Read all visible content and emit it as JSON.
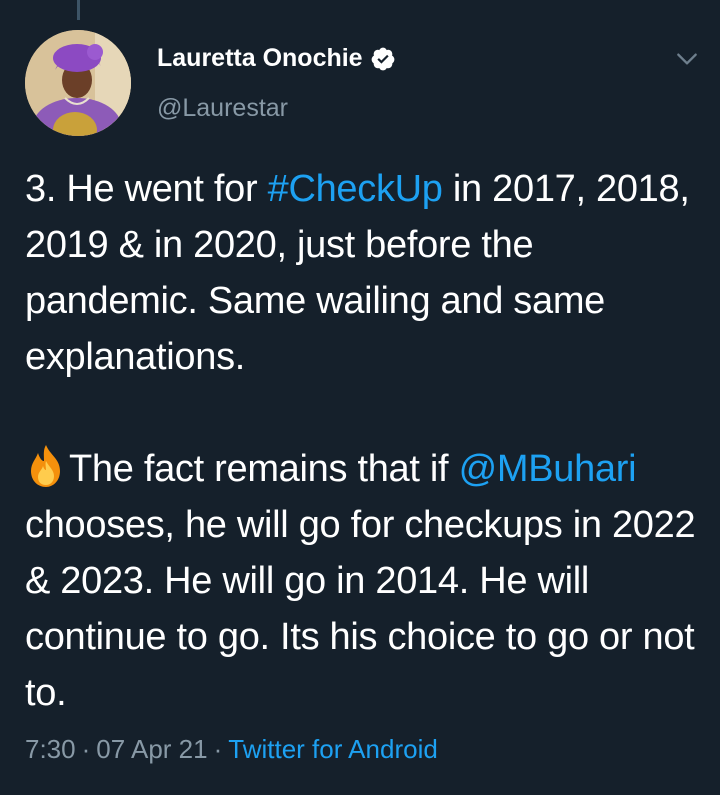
{
  "author": {
    "display_name": "Lauretta Onochie",
    "handle": "@Laurestar",
    "verified": true
  },
  "tweet": {
    "p1_a": "3. He went for ",
    "p1_hashtag": "#CheckUp",
    "p1_b": " in 2017, 2018, 2019 & in 2020, just before the pandemic. Same wailing and same explanations.",
    "p2_a": "The fact remains that if ",
    "p2_mention": "@MBuhari",
    "p2_b": " chooses, he will go for checkups in 2022 & 2023. He will go in 2014. He will continue to go. Its his choice to go or not to.",
    "emoji": "fire-icon"
  },
  "meta": {
    "time": "7:30",
    "date": "07 Apr 21",
    "source": "Twitter for Android",
    "separator": "·"
  },
  "colors": {
    "background": "#15202b",
    "link": "#1da1f2",
    "secondary_text": "#8899a6"
  }
}
